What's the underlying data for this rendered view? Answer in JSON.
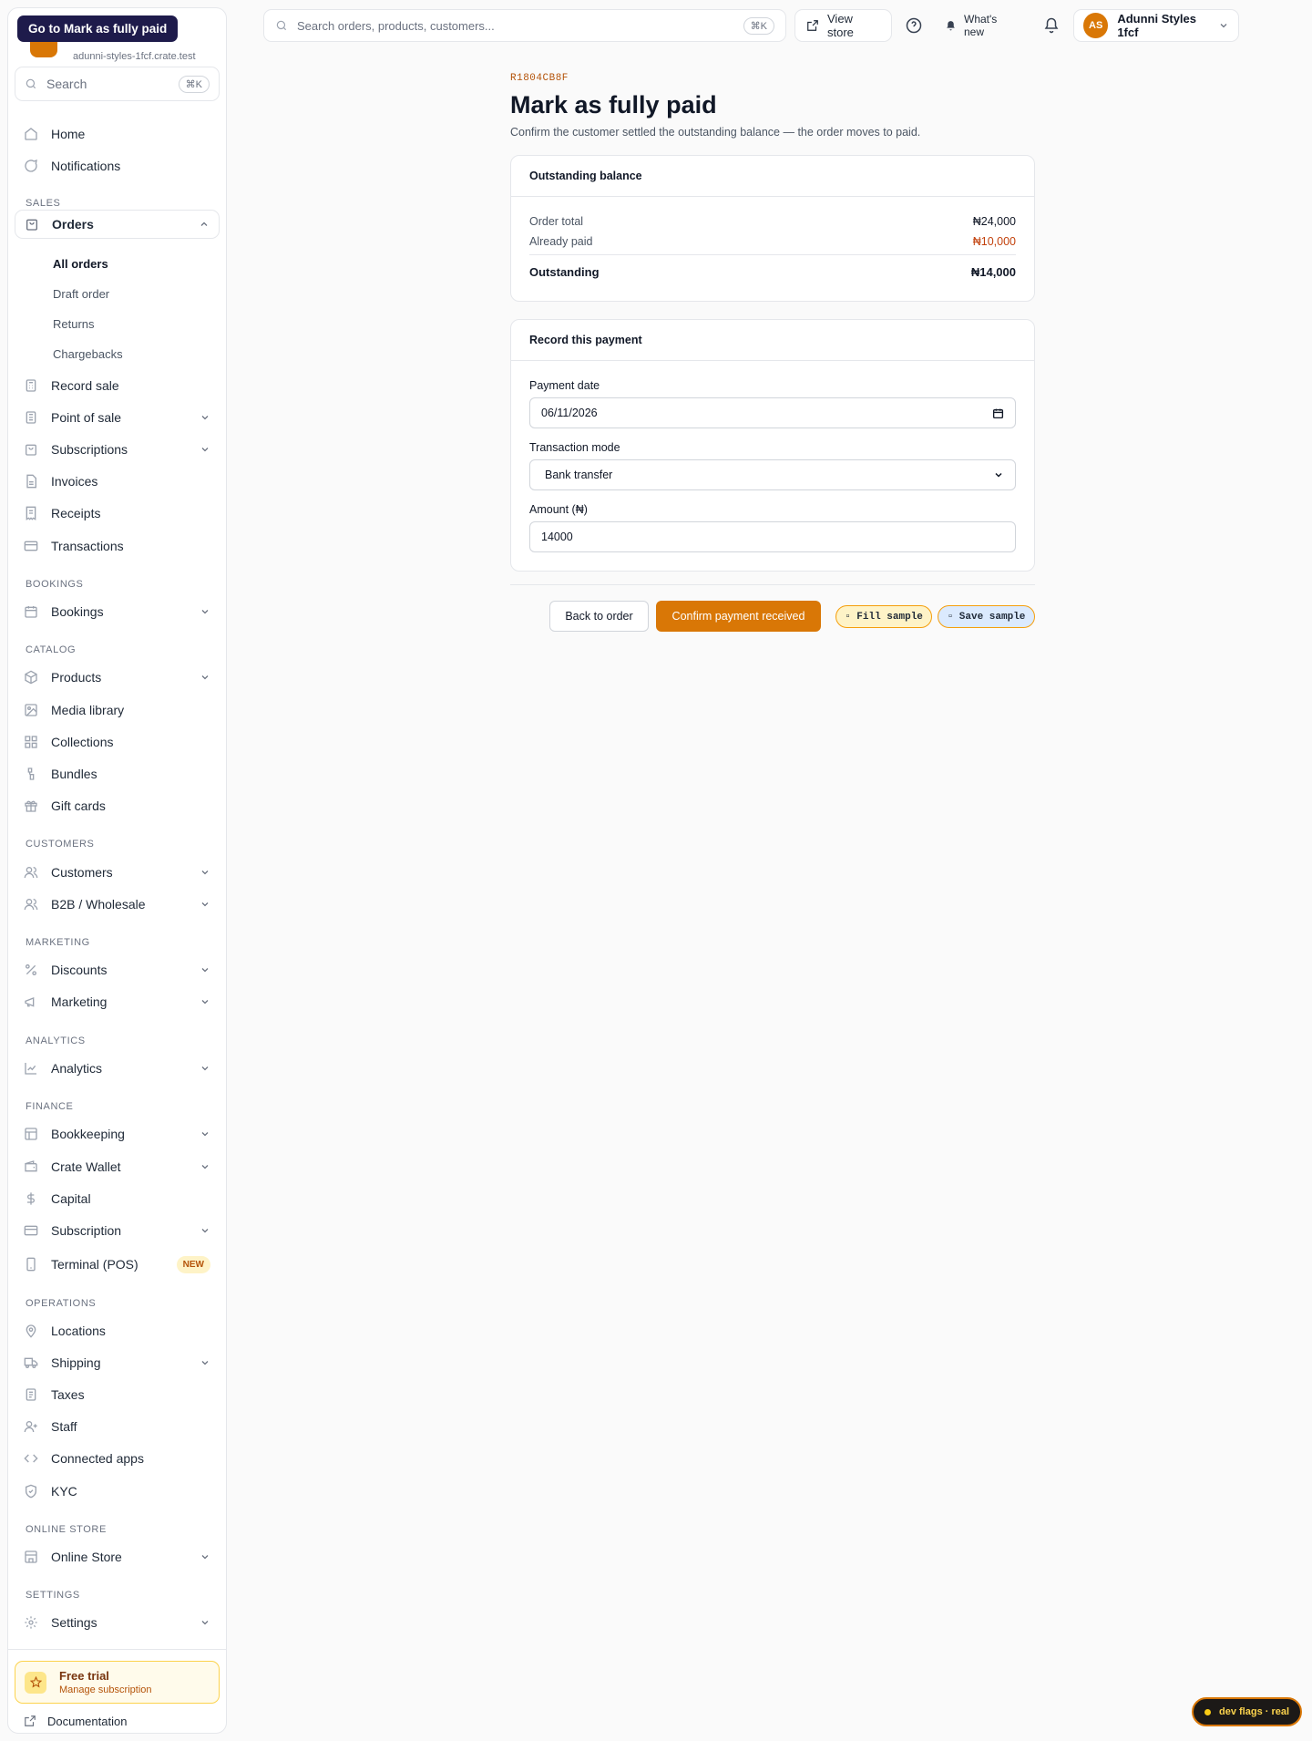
{
  "tooltip": "Go to Mark as fully paid",
  "brand": {
    "subdomain": "adunni-styles-1fcf.crate.test"
  },
  "sidebar": {
    "search": {
      "placeholder": "Search",
      "shortcut": "⌘K"
    },
    "items": {
      "home": "Home",
      "notifications": "Notifications",
      "orders": "Orders",
      "record_sale": "Record sale",
      "point_of_sale": "Point of sale",
      "subscriptions": "Subscriptions",
      "invoices": "Invoices",
      "receipts": "Receipts",
      "transactions": "Transactions",
      "bookings": "Bookings",
      "products": "Products",
      "media_library": "Media library",
      "collections": "Collections",
      "bundles": "Bundles",
      "gift_cards": "Gift cards",
      "customers": "Customers",
      "b2b": "B2B / Wholesale",
      "discounts": "Discounts",
      "marketing": "Marketing",
      "analytics": "Analytics",
      "bookkeeping": "Bookkeeping",
      "crate_wallet": "Crate Wallet",
      "capital": "Capital",
      "subscription": "Subscription",
      "terminal": "Terminal (POS)",
      "terminal_badge": "NEW",
      "locations": "Locations",
      "shipping": "Shipping",
      "taxes": "Taxes",
      "staff": "Staff",
      "connected_apps": "Connected apps",
      "kyc": "KYC",
      "online_store": "Online Store",
      "settings": "Settings"
    },
    "orders_sub": [
      "All orders",
      "Draft order",
      "Returns",
      "Chargebacks"
    ],
    "sections": {
      "sales": "SALES",
      "bookings": "BOOKINGS",
      "catalog": "CATALOG",
      "customers": "CUSTOMERS",
      "marketing": "MARKETING",
      "analytics": "ANALYTICS",
      "finance": "FINANCE",
      "operations": "OPERATIONS",
      "online_store": "ONLINE STORE",
      "settings": "SETTINGS"
    },
    "trial": {
      "title": "Free trial",
      "subtitle": "Manage subscription"
    },
    "documentation": "Documentation"
  },
  "topbar": {
    "search_placeholder": "Search orders, products, customers...",
    "search_shortcut": "⌘K",
    "view_store": "View store",
    "whats_new": "What's new",
    "account_initials": "AS",
    "account_name": "Adunni Styles 1fcf"
  },
  "page": {
    "order_id": "R1804CB8F",
    "title": "Mark as fully paid",
    "description": "Confirm the customer settled the outstanding balance — the order moves to paid."
  },
  "balance": {
    "heading": "Outstanding balance",
    "order_total_label": "Order total",
    "order_total": "₦24,000",
    "already_paid_label": "Already paid",
    "already_paid": "₦10,000",
    "outstanding_label": "Outstanding",
    "outstanding": "₦14,000"
  },
  "payment": {
    "heading": "Record this payment",
    "date_label": "Payment date",
    "date_value": "06/11/2026",
    "mode_label": "Transaction mode",
    "mode_value": "Bank transfer",
    "amount_label": "Amount (₦)",
    "amount_value": "14000"
  },
  "actions": {
    "back": "Back to order",
    "confirm": "Confirm payment received",
    "fill_sample": "▫ Fill sample",
    "save_sample": "▫ Save sample"
  },
  "dev_flags": "dev flags · real",
  "colors": {
    "accent": "#d97706",
    "paid": "#c2410c"
  }
}
